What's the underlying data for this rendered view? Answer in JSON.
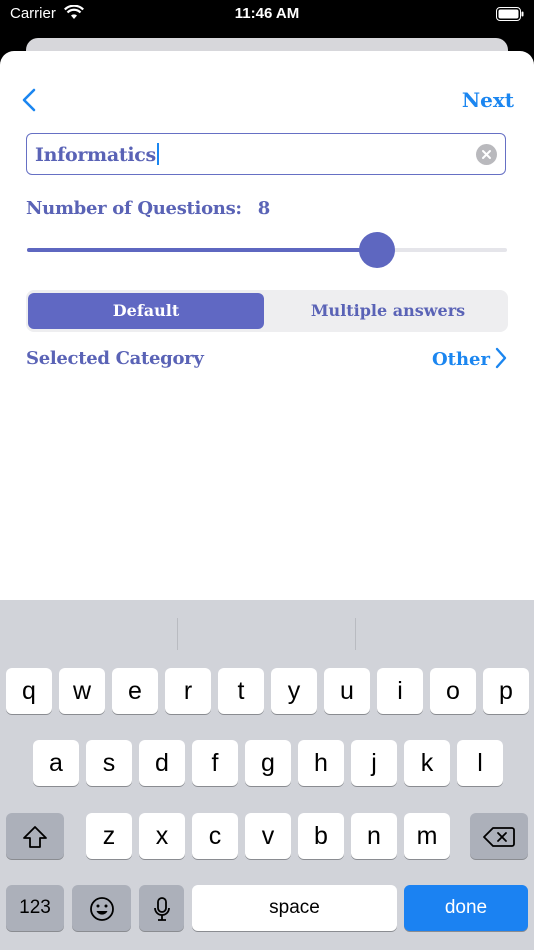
{
  "status_bar": {
    "carrier": "Carrier",
    "time": "11:46 AM"
  },
  "nav": {
    "next_label": "Next"
  },
  "search": {
    "value": "Informatics"
  },
  "questions": {
    "label": "Number of Questions:",
    "count": "8",
    "slider_fraction": 0.73
  },
  "mode": {
    "options": [
      "Default",
      "Multiple answers"
    ],
    "selected": "Default"
  },
  "category": {
    "label": "Selected Category",
    "value": "Other"
  },
  "keyboard": {
    "row1": [
      "q",
      "w",
      "e",
      "r",
      "t",
      "y",
      "u",
      "i",
      "o",
      "p"
    ],
    "row2": [
      "a",
      "s",
      "d",
      "f",
      "g",
      "h",
      "j",
      "k",
      "l"
    ],
    "row3": [
      "z",
      "x",
      "c",
      "v",
      "b",
      "n",
      "m"
    ],
    "numbers_label": "123",
    "space_label": "space",
    "done_label": "done"
  },
  "colors": {
    "accent": "#6068c3",
    "link": "#1b86f0"
  }
}
